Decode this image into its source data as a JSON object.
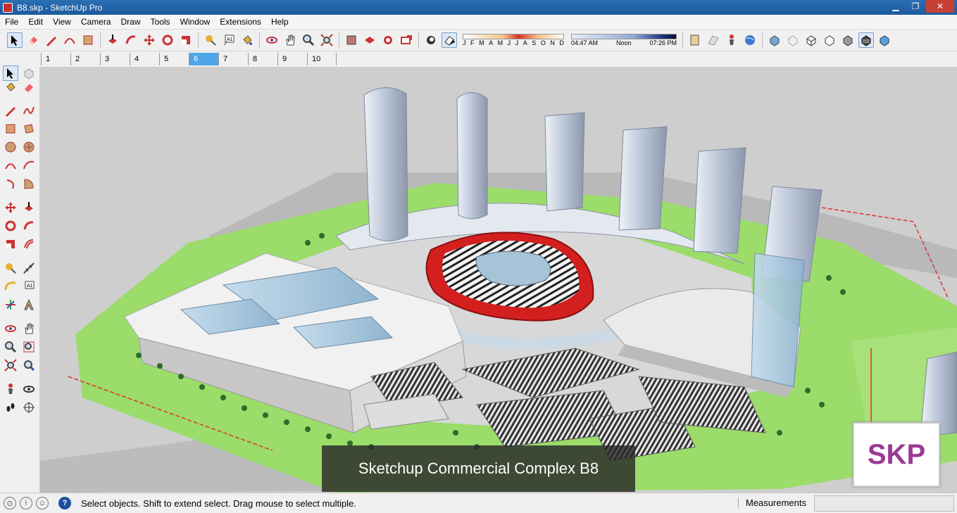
{
  "window": {
    "title": "B8.skp - SketchUp Pro",
    "minimize": "▁",
    "restore": "❐",
    "close": "✕"
  },
  "menu": [
    "File",
    "Edit",
    "View",
    "Camera",
    "Draw",
    "Tools",
    "Window",
    "Extensions",
    "Help"
  ],
  "shadow": {
    "months": [
      "J",
      "F",
      "M",
      "A",
      "M",
      "J",
      "J",
      "A",
      "S",
      "O",
      "N",
      "D"
    ],
    "times": [
      "04:47 AM",
      "Noon",
      "07:26 PM"
    ]
  },
  "scenes": [
    {
      "label": "1",
      "active": false
    },
    {
      "label": "2",
      "active": false
    },
    {
      "label": "3",
      "active": false
    },
    {
      "label": "4",
      "active": false
    },
    {
      "label": "5",
      "active": false
    },
    {
      "label": "6",
      "active": true
    },
    {
      "label": "7",
      "active": false
    },
    {
      "label": "8",
      "active": false
    },
    {
      "label": "9",
      "active": false
    },
    {
      "label": "10",
      "active": false
    }
  ],
  "viewport": {
    "caption": "Sketchup Commercial Complex B8",
    "logo": "SKP"
  },
  "status": {
    "help": "?",
    "text": "Select objects. Shift to extend select. Drag mouse to select multiple.",
    "measurements_label": "Measurements",
    "measurements_value": ""
  },
  "colors": {
    "titlebar": "#1c5a9c",
    "active_scene": "#4ea6e8",
    "stadium": "#d3201e",
    "grass": "#9bdc6a",
    "logo": "#9b3a96"
  }
}
